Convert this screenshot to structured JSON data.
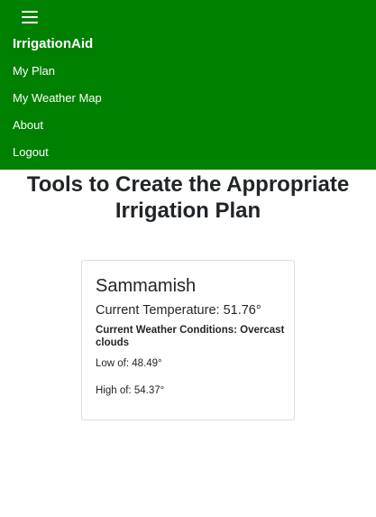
{
  "navbar": {
    "brand": "IrrigationAid",
    "background_color": "#008000",
    "menu_icon": "hamburger-menu-icon",
    "items": [
      {
        "label": "My Plan"
      },
      {
        "label": "My Weather Map"
      },
      {
        "label": "About"
      },
      {
        "label": "Logout"
      }
    ]
  },
  "main": {
    "heading": "Tools to Create the Appropriate Irrigation Plan"
  },
  "weather_card": {
    "city": "Sammamish",
    "current_temperature": "Current Temperature: 51.76°",
    "current_conditions": "Current Weather Conditions: Overcast clouds",
    "low": "Low of: 48.49°",
    "high": "High of: 54.37°"
  }
}
